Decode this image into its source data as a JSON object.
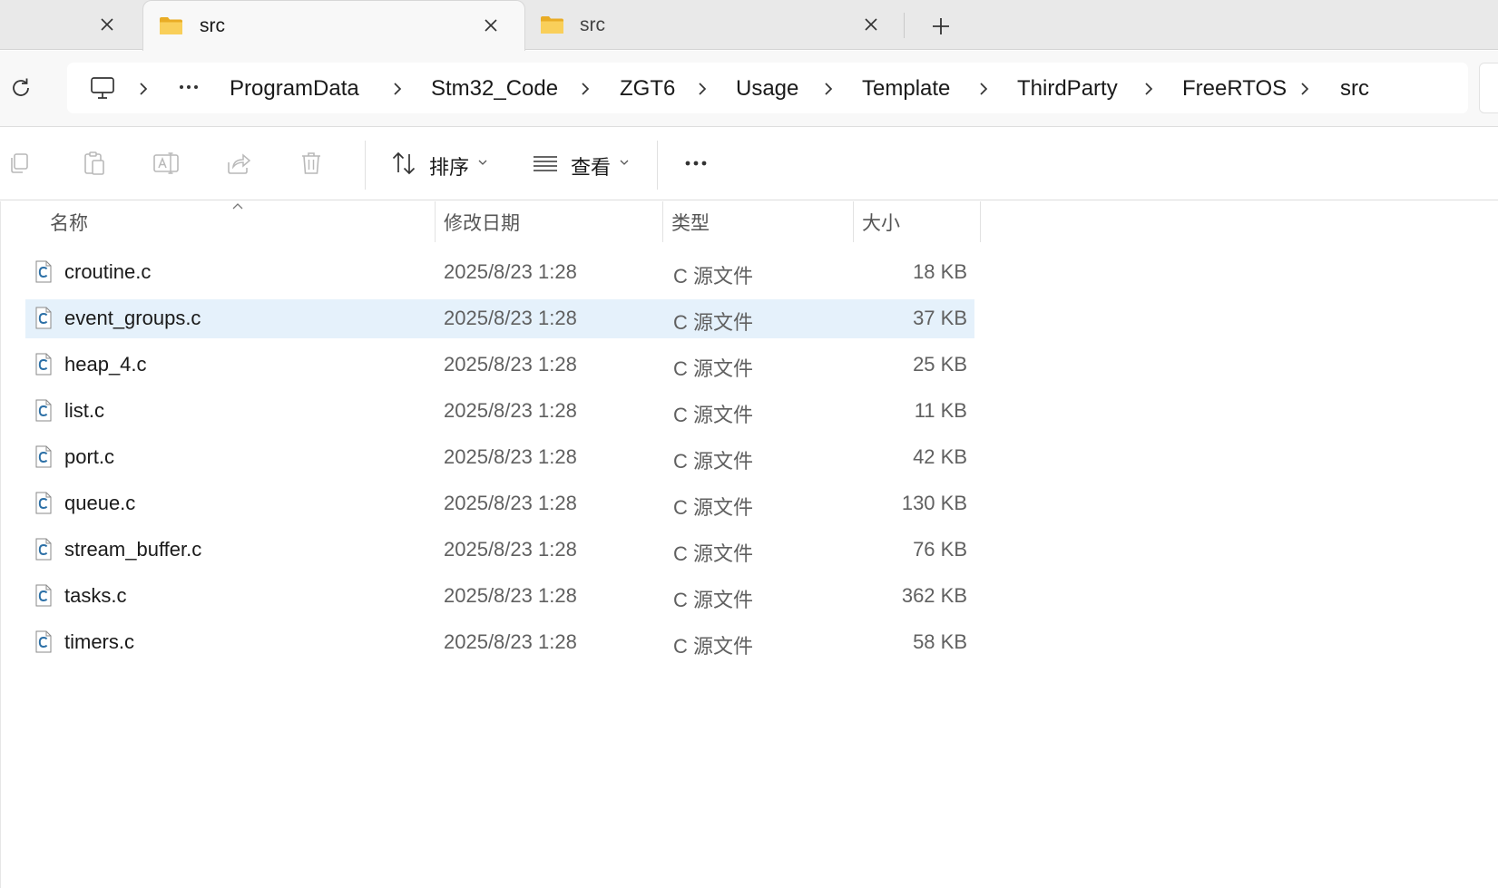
{
  "tabs": [
    {
      "label": "",
      "state": "partial"
    },
    {
      "label": "src",
      "state": "active"
    },
    {
      "label": "src",
      "state": "inactive"
    }
  ],
  "breadcrumb": [
    "ProgramData",
    "Stm32_Code",
    "ZGT6",
    "Usage",
    "Template",
    "ThirdParty",
    "FreeRTOS",
    "src"
  ],
  "toolbar": {
    "sort_label": "排序",
    "view_label": "查看"
  },
  "columns": {
    "name": "名称",
    "date": "修改日期",
    "type": "类型",
    "size": "大小"
  },
  "files": [
    {
      "name": "croutine.c",
      "date": "2025/8/23 1:28",
      "type": "C 源文件",
      "size": "18 KB"
    },
    {
      "name": "event_groups.c",
      "date": "2025/8/23 1:28",
      "type": "C 源文件",
      "size": "37 KB",
      "selected": true
    },
    {
      "name": "heap_4.c",
      "date": "2025/8/23 1:28",
      "type": "C 源文件",
      "size": "25 KB"
    },
    {
      "name": "list.c",
      "date": "2025/8/23 1:28",
      "type": "C 源文件",
      "size": "11 KB"
    },
    {
      "name": "port.c",
      "date": "2025/8/23 1:28",
      "type": "C 源文件",
      "size": "42 KB"
    },
    {
      "name": "queue.c",
      "date": "2025/8/23 1:28",
      "type": "C 源文件",
      "size": "130 KB"
    },
    {
      "name": "stream_buffer.c",
      "date": "2025/8/23 1:28",
      "type": "C 源文件",
      "size": "76 KB"
    },
    {
      "name": "tasks.c",
      "date": "2025/8/23 1:28",
      "type": "C 源文件",
      "size": "362 KB"
    },
    {
      "name": "timers.c",
      "date": "2025/8/23 1:28",
      "type": "C 源文件",
      "size": "58 KB"
    }
  ],
  "icons": {
    "folder": "folder-icon",
    "file": "c-source-file-icon",
    "refresh": "refresh-icon",
    "computer": "computer-icon"
  },
  "colors": {
    "selection": "#e5f1fb",
    "folder": "#f6c544",
    "file_accent": "#2b6fa6"
  }
}
